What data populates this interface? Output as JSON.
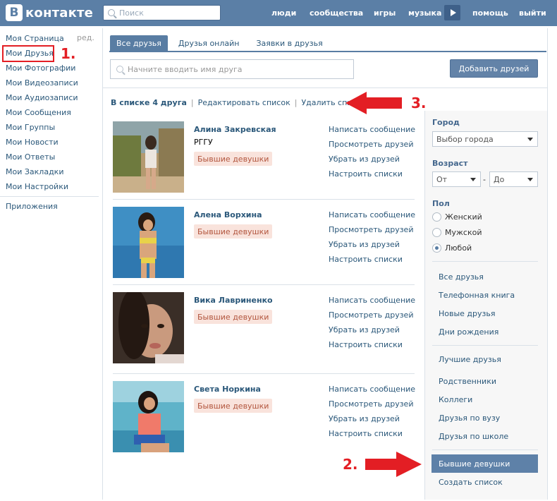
{
  "header": {
    "logo_letter": "В",
    "logo_text": "контакте",
    "search_placeholder": "Поиск",
    "nav": [
      "люди",
      "сообщества",
      "игры",
      "музыка",
      "помощь",
      "выйти"
    ]
  },
  "leftmenu": {
    "items": [
      "Моя Страница",
      "Мои Друзья",
      "Мои Фотографии",
      "Мои Видеозаписи",
      "Мои Аудиозаписи",
      "Мои Сообщения",
      "Мои Группы",
      "Мои Новости",
      "Мои Ответы",
      "Мои Закладки",
      "Мои Настройки"
    ],
    "edit": "ред.",
    "apps": "Приложения"
  },
  "tabs": [
    "Все друзья",
    "Друзья онлайн",
    "Заявки в друзья"
  ],
  "filter_placeholder": "Начните вводить имя друга",
  "add_button": "Добавить друзей",
  "summary": {
    "count": "В списке 4 друга",
    "edit": "Редактировать список",
    "delete": "Удалить список"
  },
  "friends": [
    {
      "name": "Алина Закревская",
      "uni": "РГГУ",
      "badge": "Бывшие девушки"
    },
    {
      "name": "Алена Ворхина",
      "uni": "",
      "badge": "Бывшие девушки"
    },
    {
      "name": "Вика Лавриненко",
      "uni": "",
      "badge": "Бывшие девушки"
    },
    {
      "name": "Света Норкина",
      "uni": "",
      "badge": "Бывшие девушки"
    }
  ],
  "friend_actions": [
    "Написать сообщение",
    "Просмотреть друзей",
    "Убрать из друзей",
    "Настроить списки"
  ],
  "filters": {
    "city_label": "Город",
    "city_value": "Выбор города",
    "age_label": "Возраст",
    "age_from": "От",
    "age_dash": "-",
    "age_to": "До",
    "sex_label": "Пол",
    "sex_options": [
      "Женский",
      "Мужской",
      "Любой"
    ],
    "sex_selected": "Любой"
  },
  "lists_a": [
    "Все друзья",
    "Телефонная книга",
    "Новые друзья",
    "Дни рождения"
  ],
  "lists_b": [
    "Лучшие друзья",
    "Родственники",
    "Коллеги",
    "Друзья по вузу",
    "Друзья по школе"
  ],
  "lists_selected": "Бывшие девушки",
  "lists_create": "Создать список",
  "annotations": [
    "1.",
    "2.",
    "3."
  ],
  "colors": {
    "header": "#5b7fa6",
    "link": "#2b587a",
    "arrow": "#e31e24",
    "badge_bg": "#f9e3dc",
    "badge_text": "#b2563e"
  }
}
